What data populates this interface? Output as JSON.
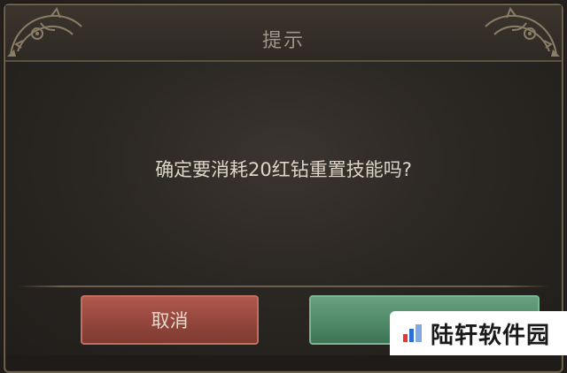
{
  "dialog": {
    "title": "提示",
    "message": "确定要消耗20红钻重置技能吗?",
    "cancel_label": "取消",
    "confirm_label": ""
  },
  "watermark": {
    "text": "陆轩软件园"
  },
  "colors": {
    "cancel_button": "#93463c",
    "confirm_button": "#4f8a67",
    "frame_gold": "#6b5f4a"
  }
}
